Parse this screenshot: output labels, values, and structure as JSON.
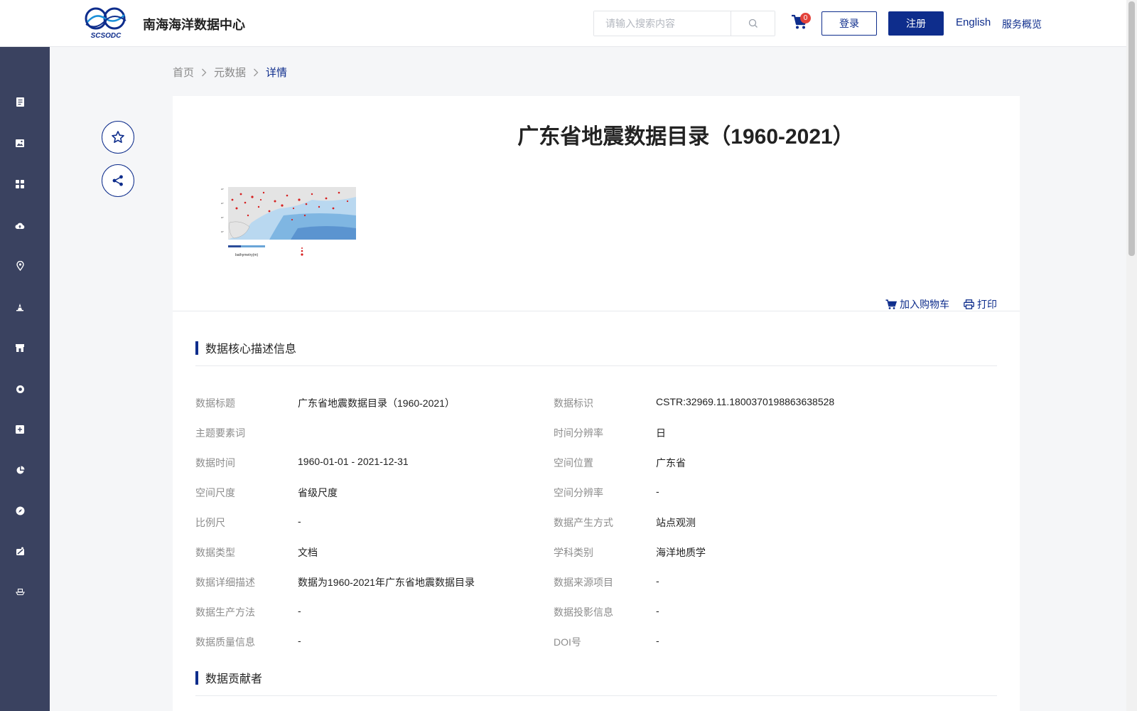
{
  "header": {
    "site_title": "南海海洋数据中心",
    "logo_text": "SCSODC",
    "search_placeholder": "请输入搜索内容",
    "cart_count": "0",
    "login_label": "登录",
    "register_label": "注册",
    "english_label": "English",
    "overview_label": "服务概览"
  },
  "breadcrumb": {
    "home": "首页",
    "metadata": "元数据",
    "current": "详情"
  },
  "sidebar": {
    "icons": [
      "document-icon",
      "image-icon",
      "grid-icon",
      "cloud-upload-icon",
      "location-pin-icon",
      "beacon-icon",
      "shop-icon",
      "lifebuoy-icon",
      "plus-box-icon",
      "pie-chart-icon",
      "compass-icon",
      "satellite-icon",
      "ship-icon"
    ]
  },
  "detail": {
    "title": "广东省地震数据目录（1960-2021）",
    "add_to_cart_label": "加入购物车",
    "print_label": "打印",
    "section_core": "数据核心描述信息",
    "section_contributors": "数据贡献者",
    "rows": [
      {
        "label1": "数据标题",
        "value1": "广东省地震数据目录（1960-2021）",
        "label2": "数据标识",
        "value2": "CSTR:32969.11.1800370198863638528"
      },
      {
        "label1": "主题要素词",
        "value1": "",
        "label2": "时间分辨率",
        "value2": "日"
      },
      {
        "label1": "数据时间",
        "value1": "1960-01-01 - 2021-12-31",
        "label2": "空间位置",
        "value2": "广东省"
      },
      {
        "label1": "空间尺度",
        "value1": "省级尺度",
        "label2": "空间分辨率",
        "value2": "-"
      },
      {
        "label1": "比例尺",
        "value1": "-",
        "label2": "数据产生方式",
        "value2": "站点观测"
      },
      {
        "label1": "数据类型",
        "value1": "文档",
        "label2": "学科类别",
        "value2": "海洋地质学"
      },
      {
        "label1": "数据详细描述",
        "value1": "数据为1960-2021年广东省地震数据目录",
        "label2": "数据来源项目",
        "value2": "-"
      },
      {
        "label1": "数据生产方法",
        "value1": "-",
        "label2": "数据投影信息",
        "value2": "-"
      },
      {
        "label1": "数据质量信息",
        "value1": "-",
        "label2": "DOI号",
        "value2": "-"
      }
    ],
    "thumbnail_legend": "bathymetry(m)"
  },
  "colors": {
    "primary": "#0e2d8c",
    "sidebar_bg": "#3a4260",
    "badge": "#e3423a"
  }
}
